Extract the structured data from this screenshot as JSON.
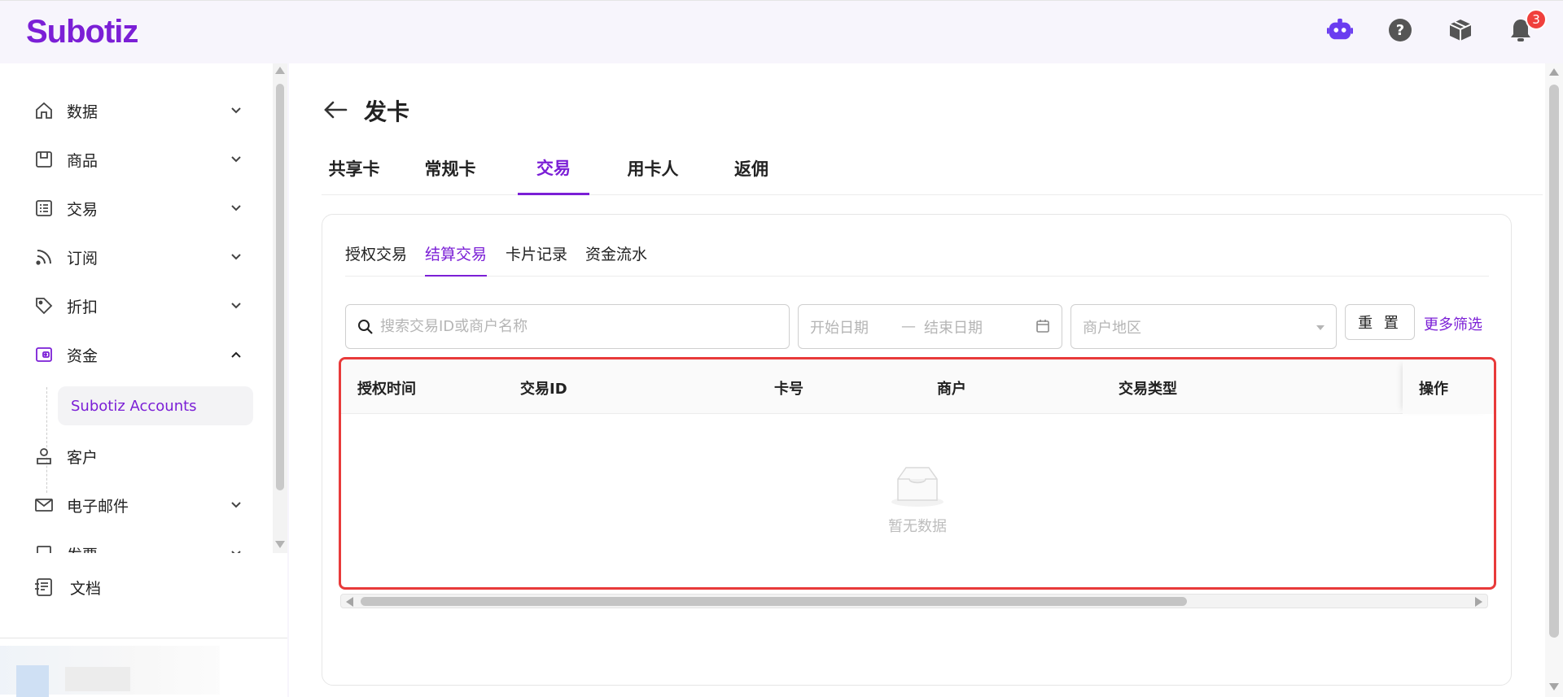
{
  "app": {
    "logo": "Subotiz",
    "brand_color": "#7b1fd6",
    "notification_count": "3"
  },
  "topbar": {
    "icons": [
      "assistant-bot-icon",
      "help-icon",
      "package-icon",
      "bell-icon"
    ]
  },
  "sidebar": {
    "items": [
      {
        "label": "数据",
        "icon": "home-icon",
        "expanded": false
      },
      {
        "label": "商品",
        "icon": "store-icon",
        "expanded": false
      },
      {
        "label": "交易",
        "icon": "list-icon",
        "expanded": false
      },
      {
        "label": "订阅",
        "icon": "rss-icon",
        "expanded": false
      },
      {
        "label": "折扣",
        "icon": "tag-icon",
        "expanded": false
      },
      {
        "label": "资金",
        "icon": "wallet-icon",
        "expanded": true
      },
      {
        "label": "客户",
        "icon": "user-icon",
        "expanded": false
      },
      {
        "label": "电子邮件",
        "icon": "mail-icon",
        "expanded": false
      },
      {
        "label": "发票",
        "icon": "invoice-icon",
        "expanded": false
      }
    ],
    "sub_item": "Subotiz Accounts",
    "docs": "文档"
  },
  "page": {
    "title": "发卡",
    "tabs": [
      "共享卡",
      "常规卡",
      "交易",
      "用卡人",
      "返佣"
    ],
    "active_tab": "交易",
    "subtabs": [
      "授权交易",
      "结算交易",
      "卡片记录",
      "资金流水"
    ],
    "active_subtab": "结算交易"
  },
  "filters": {
    "search_placeholder": "搜索交易ID或商户名称",
    "start_date": "开始日期",
    "date_sep": "—",
    "end_date": "结束日期",
    "region_placeholder": "商户地区",
    "reset": "重 置",
    "more": "更多筛选"
  },
  "table": {
    "columns": [
      "授权时间",
      "交易ID",
      "卡号",
      "商户",
      "交易类型",
      "操作"
    ],
    "rows": [],
    "empty_text": "暂无数据"
  }
}
